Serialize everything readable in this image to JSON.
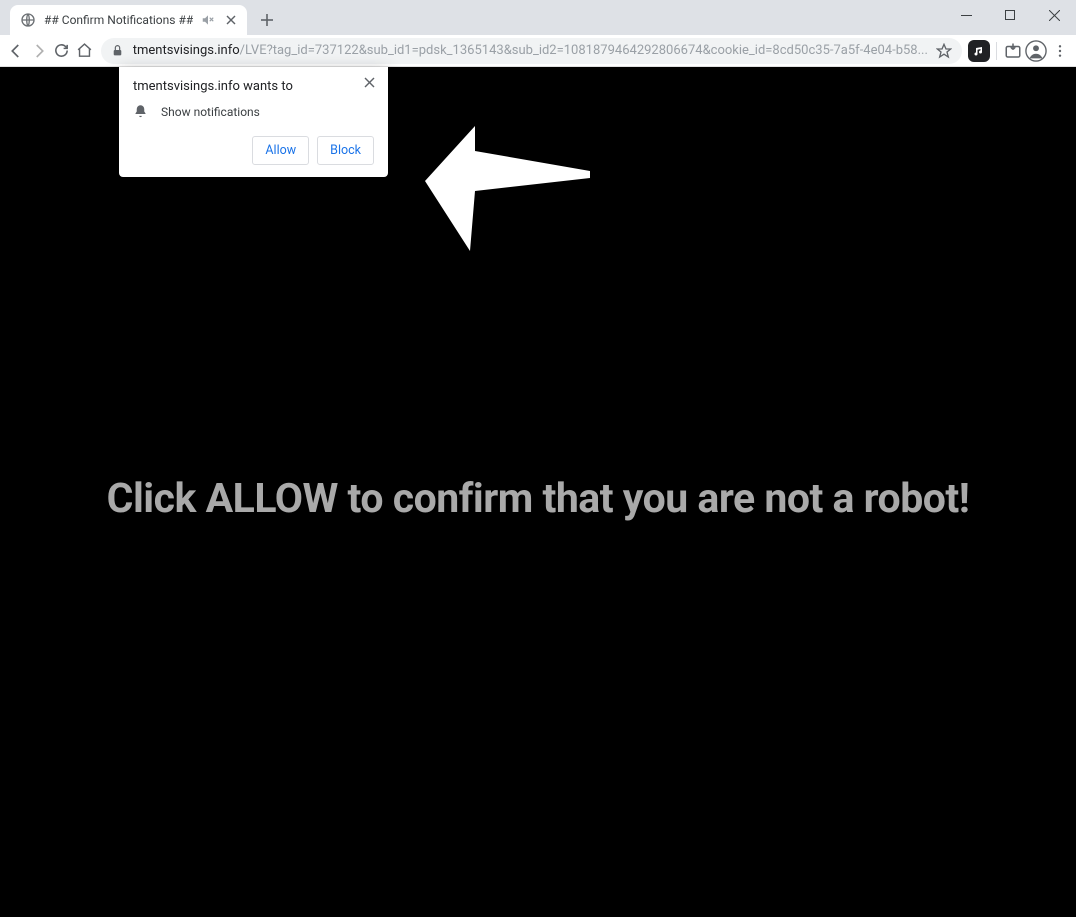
{
  "tab": {
    "title": "## Confirm Notifications ##"
  },
  "omnibox": {
    "host": "tmentsvisings.info",
    "path": "/LVE?tag_id=737122&sub_id1=pdsk_1365143&sub_id2=1081879464292806674&cookie_id=8cd50c35-7a5f-4e04-b58..."
  },
  "notification_prompt": {
    "origin_text": "tmentsvisings.info wants to",
    "permission_label": "Show notifications",
    "allow_label": "Allow",
    "block_label": "Block"
  },
  "page": {
    "headline": "Click ALLOW to confirm that you are not a robot!"
  }
}
